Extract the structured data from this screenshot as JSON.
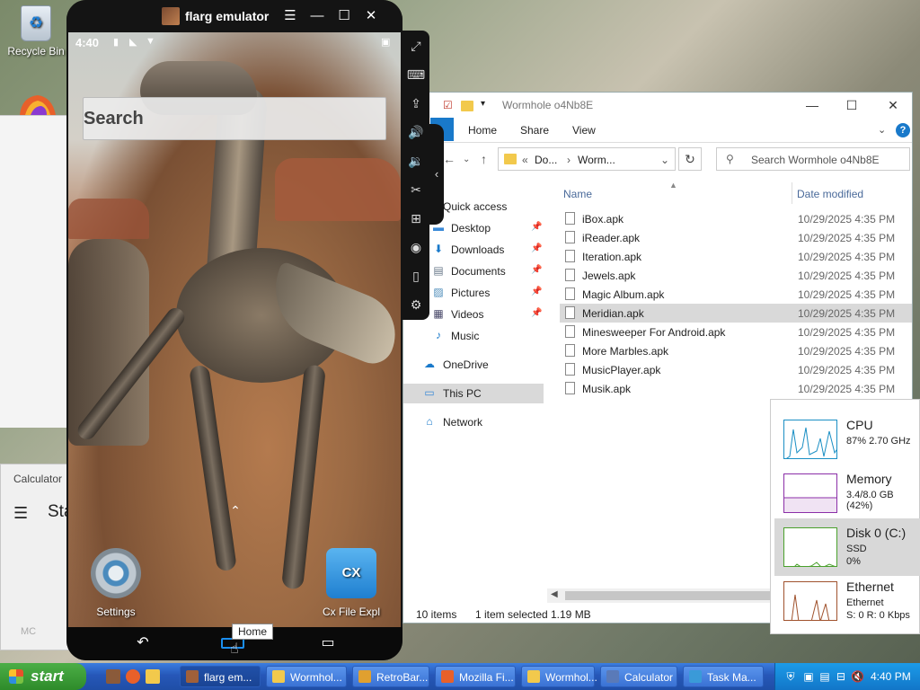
{
  "desktop": {
    "recycle_bin_label": "Recycle Bin"
  },
  "calculator_bg": {
    "title": "Calculator",
    "mode_partial": "Sta",
    "memory_partial": "MC"
  },
  "emulator": {
    "title": "flarg emulator",
    "status_time": "4:40",
    "search_placeholder": "Search",
    "apps": [
      {
        "label": "Settings"
      },
      {
        "label": "Cx File Expl"
      }
    ],
    "cx_icon_text": "CX",
    "home_tooltip": "Home"
  },
  "explorer": {
    "title": "Wormhole o4Nb8E",
    "ribbon_tabs": [
      "Home",
      "Share",
      "View"
    ],
    "address": {
      "part1": "Do...",
      "part2": "Worm..."
    },
    "search_placeholder": "Search Wormhole o4Nb8E",
    "nav_items": [
      {
        "label": "Quick access",
        "icon": "star-icon",
        "pinned": false
      },
      {
        "label": "Desktop",
        "icon": "desktop-folder-icon",
        "pinned": true
      },
      {
        "label": "Downloads",
        "icon": "download-arrow-icon",
        "pinned": true
      },
      {
        "label": "Documents",
        "icon": "documents-icon",
        "pinned": true
      },
      {
        "label": "Pictures",
        "icon": "pictures-icon",
        "pinned": true
      },
      {
        "label": "Videos",
        "icon": "film-icon",
        "pinned": true
      },
      {
        "label": "Music",
        "icon": "music-note-icon",
        "pinned": false
      },
      {
        "label": "OneDrive",
        "icon": "cloud-icon",
        "pinned": false
      },
      {
        "label": "This PC",
        "icon": "monitor-icon",
        "pinned": false
      },
      {
        "label": "Network",
        "icon": "network-icon",
        "pinned": false
      }
    ],
    "columns": {
      "name": "Name",
      "date": "Date modified"
    },
    "files": [
      {
        "name": "iBox.apk",
        "date": "10/29/2025 4:35 PM"
      },
      {
        "name": "iReader.apk",
        "date": "10/29/2025 4:35 PM"
      },
      {
        "name": "Iteration.apk",
        "date": "10/29/2025 4:35 PM"
      },
      {
        "name": "Jewels.apk",
        "date": "10/29/2025 4:35 PM"
      },
      {
        "name": "Magic Album.apk",
        "date": "10/29/2025 4:35 PM"
      },
      {
        "name": "Meridian.apk",
        "date": "10/29/2025 4:35 PM"
      },
      {
        "name": "Minesweeper For Android.apk",
        "date": "10/29/2025 4:35 PM"
      },
      {
        "name": "More Marbles.apk",
        "date": "10/29/2025 4:35 PM"
      },
      {
        "name": "MusicPlayer.apk",
        "date": "10/29/2025 4:35 PM"
      },
      {
        "name": "Musik.apk",
        "date": "10/29/2025 4:35 PM"
      }
    ],
    "selected_file_index": 5,
    "status": {
      "count": "10 items",
      "selected": "1 item selected",
      "size": "1.19 MB"
    }
  },
  "taskmgr": {
    "items": [
      {
        "name": "CPU",
        "sub": "87% 2.70 GHz",
        "sub2": "",
        "color": "#1a8fc4"
      },
      {
        "name": "Memory",
        "sub": "3.4/8.0 GB (42%)",
        "sub2": "",
        "color": "#8b2fa8"
      },
      {
        "name": "Disk 0 (C:)",
        "sub": "SSD",
        "sub2": "0%",
        "color": "#4aa02c"
      },
      {
        "name": "Ethernet",
        "sub": "Ethernet",
        "sub2": "S: 0 R: 0 Kbps",
        "color": "#a0522d"
      }
    ],
    "selected_index": 2
  },
  "taskbar": {
    "start_label": "start",
    "buttons": [
      {
        "label": "flarg em...",
        "icon_color": "#a0603a"
      },
      {
        "label": "Wormhol...",
        "icon_color": "#f2c94c"
      },
      {
        "label": "RetroBar...",
        "icon_color": "#e0a030"
      },
      {
        "label": "Mozilla Fi...",
        "icon_color": "#e8602a"
      },
      {
        "label": "Wormhol...",
        "icon_color": "#f2c94c"
      },
      {
        "label": "Calculator",
        "icon_color": "#5a7ab8"
      },
      {
        "label": "Task Ma...",
        "icon_color": "#3a9ad8"
      }
    ],
    "active_index": 0,
    "clock": "4:40 PM"
  }
}
